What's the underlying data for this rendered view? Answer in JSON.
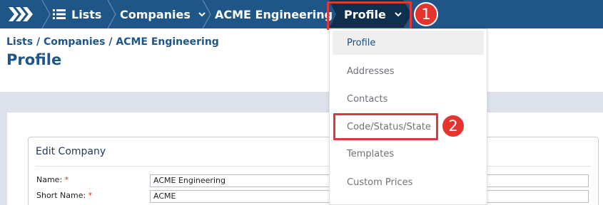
{
  "nav": {
    "lists_label": "Lists",
    "companies_label": "Companies",
    "company_label": "ACME Engineering",
    "profile_label": "Profile",
    "chevron": "⌄"
  },
  "annotations": {
    "badge1": "1",
    "badge2": "2"
  },
  "page": {
    "breadcrumb": "Lists / Companies / ACME Engineering",
    "title": "Profile"
  },
  "card": {
    "title": "Edit Company",
    "fields": [
      {
        "label": "Name:",
        "required": "*",
        "value": "ACME Engineering"
      },
      {
        "label": "Short Name:",
        "required": "*",
        "value": "ACME"
      }
    ]
  },
  "dropdown": {
    "items": [
      {
        "label": "Profile",
        "active": true
      },
      {
        "label": "Addresses"
      },
      {
        "label": "Contacts"
      },
      {
        "label": "Code/Status/State"
      },
      {
        "label": "Templates"
      },
      {
        "label": "Custom Prices"
      }
    ]
  },
  "colors": {
    "nav_bg": "#1f5687",
    "active_crumb_bg": "#0f2f4e",
    "callout": "#e0373d",
    "content_bg": "#dde1ec"
  },
  "icons": [
    "app-logo-chevrons-icon",
    "list-icon",
    "chevron-down-icon",
    "breadcrumb-separator-icon"
  ]
}
